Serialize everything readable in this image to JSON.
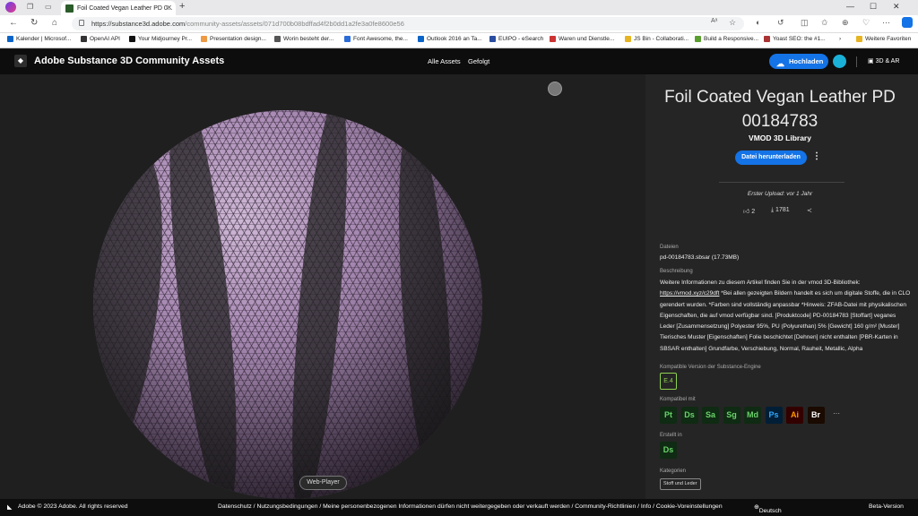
{
  "browser": {
    "tab_title": "Foil Coated Vegan Leather PD 0...",
    "url_base": "https://substance3d.adobe.com",
    "url_path": "/community-assets/assets/071d700b08bdffad4f2b0dd1a2fe3a0fe8600e56"
  },
  "bookmarks": [
    "Kalender | Microsof...",
    "OpenAI API",
    "Your Midjourney Pr...",
    "Presentation design...",
    "Worin besteht der...",
    "Font Awesome, the...",
    "Outlook 2016 an Ta...",
    "EUIPO - eSearch",
    "Waren und Dienstle...",
    "JS Bin - Collaborati...",
    "Build a Responsive...",
    "Yoast SEO: the #1...",
    "Weitere Favoriten"
  ],
  "header": {
    "brand": "Adobe Substance 3D Community Assets",
    "nav": [
      "Alle Assets",
      "Gefolgt"
    ],
    "upload": "Hochladen",
    "ar": "3D & AR"
  },
  "viewer": {
    "webplayer": "Web-Player"
  },
  "asset": {
    "title": "Foil Coated Vegan Leather PD 00184783",
    "library": "VMOD 3D Library",
    "download": "Datei herunterladen",
    "upload_info": "Erster Upload: vor 1 Jahr",
    "likes": "2",
    "downloads": "1781"
  },
  "details": {
    "files_label": "Dateien",
    "file": "pd-00184783.sbsar (17.73MB)",
    "desc_label": "Beschreibung",
    "desc_pre": "Weitere Informationen zu diesem Artikel finden Sie in der vmod 3D-Bibliothek: ",
    "desc_link": "https://vmod.xyz/c29dft",
    "desc_post": " *Bei allen gezeigten Bildern handelt es sich um digitale Stoffe, die in CLO gerendert wurden. *Farben sind vollständig anpassbar *Hinweis: ZFAB-Datei mit physikalischen Eigenschaften, die auf vmod verfügbar sind. [Produktcode] PD-00184783 [Stoffart] veganes Leder [Zusammensetzung] Polyester 95%, PU (Polyurethan) 5% [Gewicht] 160 g/m² [Muster] Tierisches Muster [Eigenschaften] Folie beschichtet [Dehnen] nicht enthalten [PBR-Karten in SBSAR enthalten] Grundfarbe, Verschiebung, Normal, Rauheit, Metallic, Alpha",
    "engine_label": "Kompatible Version der Substance-Engine",
    "engine": "E.4",
    "compat_label": "Kompatibel mit",
    "compat": [
      "Pt",
      "Ds",
      "Sa",
      "Sg",
      "Md",
      "Ps",
      "Ai",
      "Br"
    ],
    "compat_more": "···",
    "created_label": "Erstellt in",
    "created": "Ds",
    "cat_label": "Kategorien",
    "category": "Stoff und Leder"
  },
  "footer": {
    "copyright": "Adobe © 2023 Adobe. All rights reserved",
    "links": "Datenschutz  /  Nutzungsbedingungen  /  Meine personenbezogenen Informationen dürfen nicht weitergegeben oder verkauft werden  /  Community-Richtlinien  /  Info  /  Cookie-Voreinstellungen",
    "lang": "Deutsch",
    "beta": "Beta-Version"
  },
  "colors": {
    "accent": "#1473e6",
    "engine": "#8fd14f"
  }
}
